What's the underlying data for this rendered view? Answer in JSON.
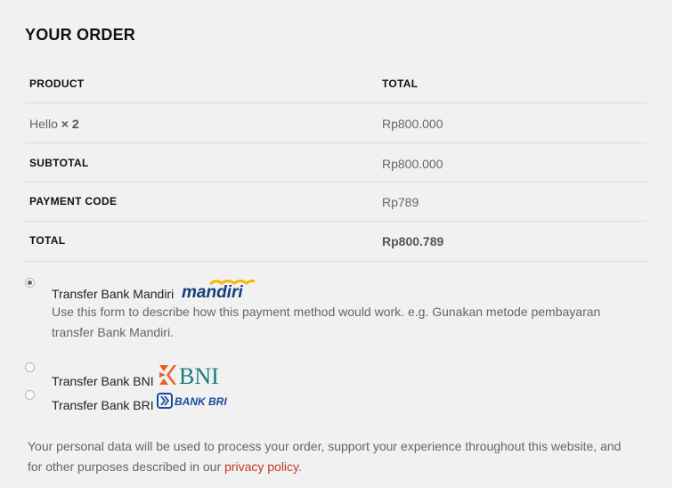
{
  "order": {
    "title": "YOUR ORDER",
    "columns": {
      "product": "PRODUCT",
      "total": "TOTAL"
    },
    "item": {
      "name": "Hello",
      "qty": "× 2",
      "total": "Rp800.000"
    },
    "subtotal": {
      "label": "SUBTOTAL",
      "value": "Rp800.000"
    },
    "payment_code": {
      "label": "PAYMENT CODE",
      "value": "Rp789"
    },
    "total": {
      "label": "TOTAL",
      "value": "Rp800.789"
    }
  },
  "payment_methods": [
    {
      "label": "Transfer Bank Mandiri",
      "logo_text": "mandiri",
      "selected": true,
      "description": "Use this form to describe how this payment method would work. e.g. Gunakan metode pembayaran transfer Bank Mandiri."
    },
    {
      "label": "Transfer Bank BNI",
      "logo_text": "BNI",
      "selected": false
    },
    {
      "label": "Transfer Bank BRI",
      "logo_text": "BANK BRI",
      "selected": false
    }
  ],
  "privacy": {
    "text": "Your personal data will be used to process your order, support your experience throughout this website, and for other purposes described in our ",
    "link": "privacy policy",
    "end": "."
  },
  "colors": {
    "link": "#c0392b",
    "mandiri_blue": "#123f7a",
    "mandiri_gold": "#f5b800",
    "bni_teal": "#1b7a7a",
    "bni_orange": "#f15a22",
    "bri_blue": "#1a4aa0"
  }
}
